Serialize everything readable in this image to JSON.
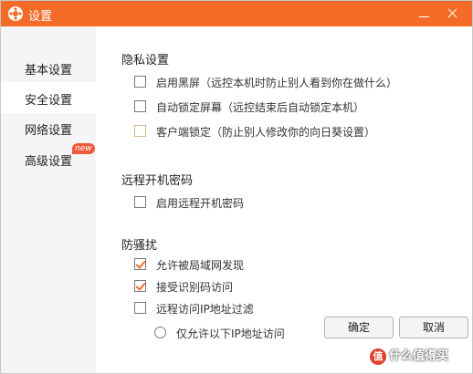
{
  "window": {
    "title": "设置"
  },
  "sidebar": {
    "items": [
      {
        "label": "基本设置",
        "active": false
      },
      {
        "label": "安全设置",
        "active": true
      },
      {
        "label": "网络设置",
        "active": false
      },
      {
        "label": "高级设置",
        "active": false,
        "badge": "new"
      }
    ]
  },
  "privacy": {
    "title": "隐私设置",
    "options": [
      {
        "label": "启用黑屏（远控本机时防止别人看到你在做什么）",
        "checked": false
      },
      {
        "label": "自动锁定屏幕（远控结束后自动锁定本机）",
        "checked": false
      },
      {
        "label": "客户端锁定（防止别人修改你的向日葵设置）",
        "checked": false
      }
    ]
  },
  "remote_boot": {
    "title": "远程开机密码",
    "options": [
      {
        "label": "启用远程开机密码",
        "checked": false
      }
    ]
  },
  "anti_harass": {
    "title": "防骚扰",
    "options": [
      {
        "label": "允许被局域网发现",
        "checked": true
      },
      {
        "label": "接受识别码访问",
        "checked": true
      },
      {
        "label": "远程访问IP地址过滤",
        "checked": false
      }
    ],
    "radio_label": "仅允许以下IP地址访问"
  },
  "buttons": {
    "ok": "确定",
    "cancel": "取消"
  },
  "watermark": {
    "badge": "值",
    "text": "什么值得买"
  },
  "colors": {
    "accent": "#f36b27",
    "sidebar_bg": "#f5f5f5",
    "badge": "#f05a3a"
  }
}
